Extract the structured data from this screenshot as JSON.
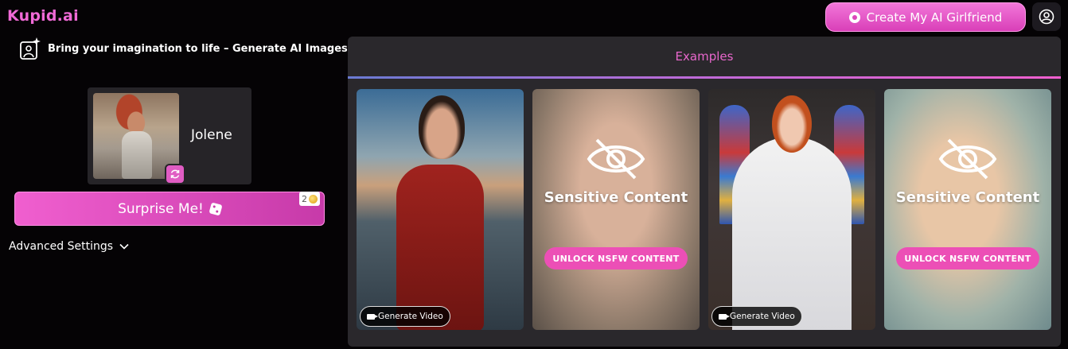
{
  "header": {
    "logo": "Kupid.ai",
    "cta_label": "Create My AI Girlfriend",
    "cta_icon": "sparkle-icon",
    "profile_icon": "user-circle-icon"
  },
  "sidebar": {
    "tagline": "Bring your imagination to life – Generate AI Images",
    "character": {
      "name": "Jolene",
      "swap_icon": "refresh-icon"
    },
    "surprise_label": "Surprise Me!",
    "cost": "2",
    "advanced_label": "Advanced Settings"
  },
  "examples": {
    "title": "Examples",
    "cards": [
      {
        "kind": "image",
        "video_label": "Generate Video"
      },
      {
        "kind": "blurred",
        "label": "Sensitive Content",
        "unlock_label": "UNLOCK NSFW CONTENT"
      },
      {
        "kind": "image",
        "video_label": "Generate Video"
      },
      {
        "kind": "blurred",
        "label": "Sensitive Content",
        "unlock_label": "UNLOCK NSFW CONTENT"
      }
    ]
  },
  "colors": {
    "accent": "#e867cc",
    "button": "#ec4fb6",
    "panel": "#2a282c",
    "background": "#050305"
  }
}
